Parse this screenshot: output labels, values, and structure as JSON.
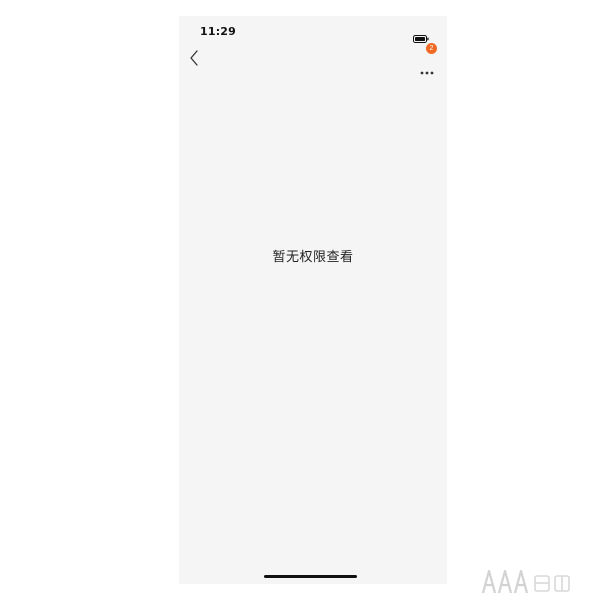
{
  "status_bar": {
    "time": "11:29"
  },
  "nav": {
    "back_icon": "chevron-left-icon",
    "more_icon": "more-dots-icon",
    "badge_count": "2",
    "badge_color": "#f06a23"
  },
  "main": {
    "empty_message": "暂无权限查看"
  },
  "colors": {
    "page_background": "#f5f5f5",
    "text": "#222222",
    "accent": "#f06a23"
  }
}
